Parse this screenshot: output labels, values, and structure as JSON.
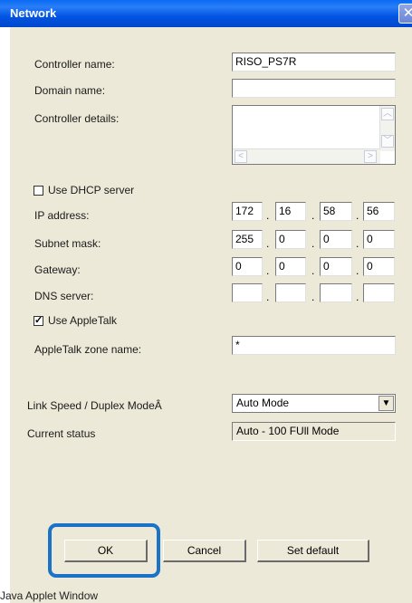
{
  "window": {
    "title": "Network",
    "close_symbol": "✕"
  },
  "fields": {
    "controller_name": {
      "label": "Controller name:",
      "value": "RISO_PS7R"
    },
    "domain_name": {
      "label": "Domain name:",
      "value": ""
    },
    "controller_details": {
      "label": "Controller details:",
      "value": ""
    }
  },
  "dhcp": {
    "label": "Use DHCP server",
    "checked": false,
    "mark": ""
  },
  "ip_address": {
    "label": "IP address:",
    "octets": [
      "172",
      "16",
      "58",
      "56"
    ]
  },
  "subnet_mask": {
    "label": "Subnet mask:",
    "octets": [
      "255",
      "0",
      "0",
      "0"
    ]
  },
  "gateway": {
    "label": "Gateway:",
    "octets": [
      "0",
      "0",
      "0",
      "0"
    ]
  },
  "dns_server": {
    "label": "DNS server:",
    "octets": [
      "",
      "",
      "",
      ""
    ]
  },
  "separator": ".",
  "appletalk": {
    "label": "Use AppleTalk",
    "checked": true,
    "mark": "✓"
  },
  "appletalk_zone": {
    "label": "AppleTalk zone name:",
    "value": "*"
  },
  "link_speed": {
    "label": "Link Speed / Duplex ModeÂ",
    "selected": "Auto Mode"
  },
  "current_status": {
    "label": "Current status",
    "value": "Auto - 100 FUll Mode"
  },
  "buttons": {
    "ok": "OK",
    "cancel": "Cancel",
    "set_default": "Set default"
  },
  "footer": "Java Applet Window",
  "colors": {
    "titlebar": "#0a5fe6",
    "dialog_bg": "#ece9d8",
    "highlight": "#1a73c7"
  },
  "icons": {
    "scroll_up": "chevron-up-icon",
    "scroll_down": "chevron-down-icon",
    "scroll_left": "chevron-left-icon",
    "scroll_right": "chevron-right-icon",
    "dropdown": "caret-down-icon"
  }
}
